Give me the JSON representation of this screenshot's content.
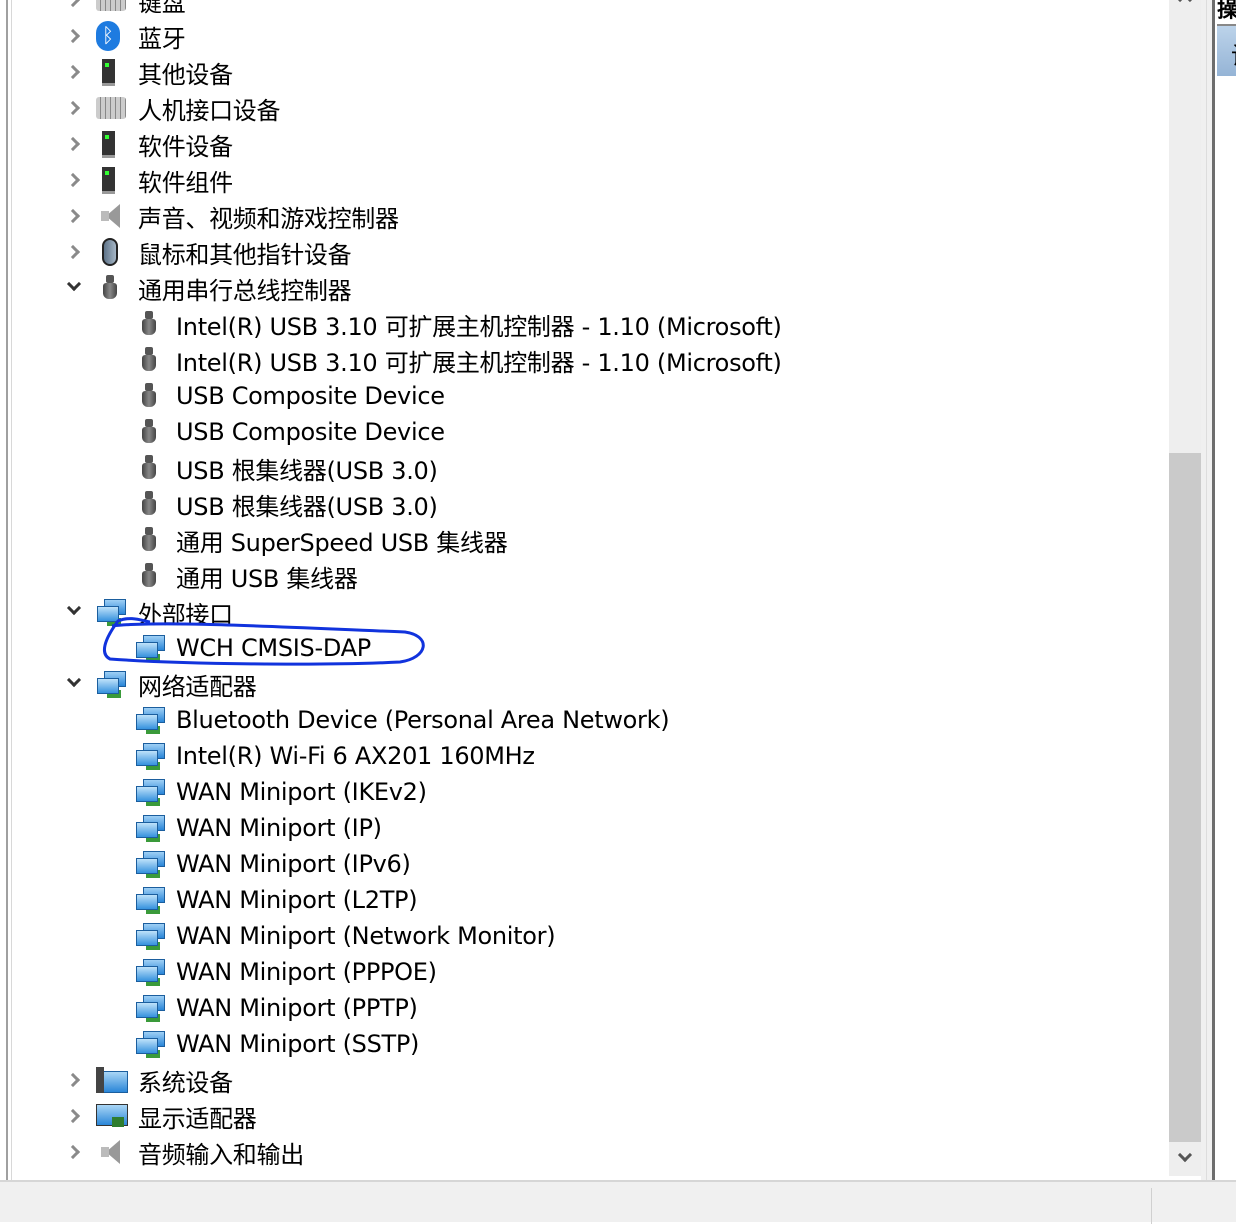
{
  "tree": {
    "items": [
      {
        "label": "键盘",
        "level": 1,
        "state": "collapsed",
        "icon": "keyboard-icon"
      },
      {
        "label": "蓝牙",
        "level": 1,
        "state": "collapsed",
        "icon": "bluetooth-icon"
      },
      {
        "label": "其他设备",
        "level": 1,
        "state": "collapsed",
        "icon": "unknown-device-icon"
      },
      {
        "label": "人机接口设备",
        "level": 1,
        "state": "collapsed",
        "icon": "hid-icon"
      },
      {
        "label": "软件设备",
        "level": 1,
        "state": "collapsed",
        "icon": "software-device-icon"
      },
      {
        "label": "软件组件",
        "level": 1,
        "state": "collapsed",
        "icon": "software-component-icon"
      },
      {
        "label": "声音、视频和游戏控制器",
        "level": 1,
        "state": "collapsed",
        "icon": "speaker-icon"
      },
      {
        "label": "鼠标和其他指针设备",
        "level": 1,
        "state": "collapsed",
        "icon": "mouse-icon"
      },
      {
        "label": "通用串行总线控制器",
        "level": 1,
        "state": "expanded",
        "icon": "usb-icon"
      },
      {
        "label": "Intel(R) USB 3.10 可扩展主机控制器 - 1.10 (Microsoft)",
        "level": 2,
        "icon": "usb-icon"
      },
      {
        "label": "Intel(R) USB 3.10 可扩展主机控制器 - 1.10 (Microsoft)",
        "level": 2,
        "icon": "usb-icon"
      },
      {
        "label": "USB Composite Device",
        "level": 2,
        "icon": "usb-icon"
      },
      {
        "label": "USB Composite Device",
        "level": 2,
        "icon": "usb-icon"
      },
      {
        "label": "USB 根集线器(USB 3.0)",
        "level": 2,
        "icon": "usb-icon"
      },
      {
        "label": "USB 根集线器(USB 3.0)",
        "level": 2,
        "icon": "usb-icon"
      },
      {
        "label": "通用 SuperSpeed USB 集线器",
        "level": 2,
        "icon": "usb-icon"
      },
      {
        "label": "通用 USB 集线器",
        "level": 2,
        "icon": "usb-icon"
      },
      {
        "label": "外部接口",
        "level": 1,
        "state": "expanded",
        "icon": "network-icon"
      },
      {
        "label": "WCH CMSIS-DAP",
        "level": 2,
        "icon": "network-icon",
        "annotated": true
      },
      {
        "label": "网络适配器",
        "level": 1,
        "state": "expanded",
        "icon": "network-icon"
      },
      {
        "label": "Bluetooth Device (Personal Area Network)",
        "level": 2,
        "icon": "network-icon"
      },
      {
        "label": "Intel(R) Wi-Fi 6 AX201 160MHz",
        "level": 2,
        "icon": "network-icon"
      },
      {
        "label": "WAN Miniport (IKEv2)",
        "level": 2,
        "icon": "network-icon"
      },
      {
        "label": "WAN Miniport (IP)",
        "level": 2,
        "icon": "network-icon"
      },
      {
        "label": "WAN Miniport (IPv6)",
        "level": 2,
        "icon": "network-icon"
      },
      {
        "label": "WAN Miniport (L2TP)",
        "level": 2,
        "icon": "network-icon"
      },
      {
        "label": "WAN Miniport (Network Monitor)",
        "level": 2,
        "icon": "network-icon"
      },
      {
        "label": "WAN Miniport (PPPOE)",
        "level": 2,
        "icon": "network-icon"
      },
      {
        "label": "WAN Miniport (PPTP)",
        "level": 2,
        "icon": "network-icon"
      },
      {
        "label": "WAN Miniport (SSTP)",
        "level": 2,
        "icon": "network-icon"
      },
      {
        "label": "系统设备",
        "level": 1,
        "state": "collapsed",
        "icon": "system-device-icon"
      },
      {
        "label": "显示适配器",
        "level": 1,
        "state": "collapsed",
        "icon": "display-adapter-icon"
      },
      {
        "label": "音频输入和输出",
        "level": 1,
        "state": "collapsed",
        "icon": "speaker-icon"
      }
    ]
  },
  "right_pane": {
    "top_text": "操",
    "highlight_text": "设"
  },
  "colors": {
    "annotation": "#1133dd",
    "scroll_thumb": "#cacaca",
    "highlight": "#a7c2e0"
  }
}
